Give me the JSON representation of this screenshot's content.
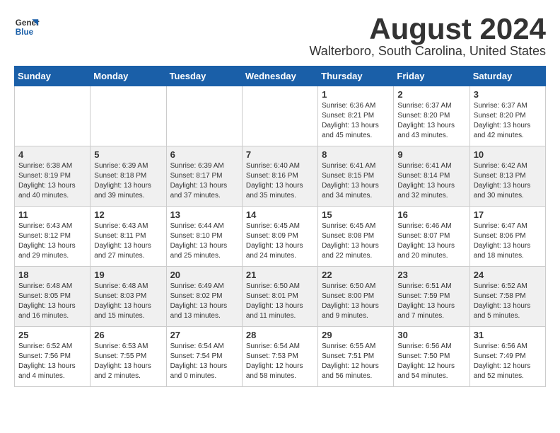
{
  "logo": {
    "line1": "General",
    "line2": "Blue"
  },
  "title": "August 2024",
  "subtitle": "Walterboro, South Carolina, United States",
  "days_of_week": [
    "Sunday",
    "Monday",
    "Tuesday",
    "Wednesday",
    "Thursday",
    "Friday",
    "Saturday"
  ],
  "weeks": [
    [
      {
        "day": "",
        "info": ""
      },
      {
        "day": "",
        "info": ""
      },
      {
        "day": "",
        "info": ""
      },
      {
        "day": "",
        "info": ""
      },
      {
        "day": "1",
        "info": "Sunrise: 6:36 AM\nSunset: 8:21 PM\nDaylight: 13 hours\nand 45 minutes."
      },
      {
        "day": "2",
        "info": "Sunrise: 6:37 AM\nSunset: 8:20 PM\nDaylight: 13 hours\nand 43 minutes."
      },
      {
        "day": "3",
        "info": "Sunrise: 6:37 AM\nSunset: 8:20 PM\nDaylight: 13 hours\nand 42 minutes."
      }
    ],
    [
      {
        "day": "4",
        "info": "Sunrise: 6:38 AM\nSunset: 8:19 PM\nDaylight: 13 hours\nand 40 minutes."
      },
      {
        "day": "5",
        "info": "Sunrise: 6:39 AM\nSunset: 8:18 PM\nDaylight: 13 hours\nand 39 minutes."
      },
      {
        "day": "6",
        "info": "Sunrise: 6:39 AM\nSunset: 8:17 PM\nDaylight: 13 hours\nand 37 minutes."
      },
      {
        "day": "7",
        "info": "Sunrise: 6:40 AM\nSunset: 8:16 PM\nDaylight: 13 hours\nand 35 minutes."
      },
      {
        "day": "8",
        "info": "Sunrise: 6:41 AM\nSunset: 8:15 PM\nDaylight: 13 hours\nand 34 minutes."
      },
      {
        "day": "9",
        "info": "Sunrise: 6:41 AM\nSunset: 8:14 PM\nDaylight: 13 hours\nand 32 minutes."
      },
      {
        "day": "10",
        "info": "Sunrise: 6:42 AM\nSunset: 8:13 PM\nDaylight: 13 hours\nand 30 minutes."
      }
    ],
    [
      {
        "day": "11",
        "info": "Sunrise: 6:43 AM\nSunset: 8:12 PM\nDaylight: 13 hours\nand 29 minutes."
      },
      {
        "day": "12",
        "info": "Sunrise: 6:43 AM\nSunset: 8:11 PM\nDaylight: 13 hours\nand 27 minutes."
      },
      {
        "day": "13",
        "info": "Sunrise: 6:44 AM\nSunset: 8:10 PM\nDaylight: 13 hours\nand 25 minutes."
      },
      {
        "day": "14",
        "info": "Sunrise: 6:45 AM\nSunset: 8:09 PM\nDaylight: 13 hours\nand 24 minutes."
      },
      {
        "day": "15",
        "info": "Sunrise: 6:45 AM\nSunset: 8:08 PM\nDaylight: 13 hours\nand 22 minutes."
      },
      {
        "day": "16",
        "info": "Sunrise: 6:46 AM\nSunset: 8:07 PM\nDaylight: 13 hours\nand 20 minutes."
      },
      {
        "day": "17",
        "info": "Sunrise: 6:47 AM\nSunset: 8:06 PM\nDaylight: 13 hours\nand 18 minutes."
      }
    ],
    [
      {
        "day": "18",
        "info": "Sunrise: 6:48 AM\nSunset: 8:05 PM\nDaylight: 13 hours\nand 16 minutes."
      },
      {
        "day": "19",
        "info": "Sunrise: 6:48 AM\nSunset: 8:03 PM\nDaylight: 13 hours\nand 15 minutes."
      },
      {
        "day": "20",
        "info": "Sunrise: 6:49 AM\nSunset: 8:02 PM\nDaylight: 13 hours\nand 13 minutes."
      },
      {
        "day": "21",
        "info": "Sunrise: 6:50 AM\nSunset: 8:01 PM\nDaylight: 13 hours\nand 11 minutes."
      },
      {
        "day": "22",
        "info": "Sunrise: 6:50 AM\nSunset: 8:00 PM\nDaylight: 13 hours\nand 9 minutes."
      },
      {
        "day": "23",
        "info": "Sunrise: 6:51 AM\nSunset: 7:59 PM\nDaylight: 13 hours\nand 7 minutes."
      },
      {
        "day": "24",
        "info": "Sunrise: 6:52 AM\nSunset: 7:58 PM\nDaylight: 13 hours\nand 5 minutes."
      }
    ],
    [
      {
        "day": "25",
        "info": "Sunrise: 6:52 AM\nSunset: 7:56 PM\nDaylight: 13 hours\nand 4 minutes."
      },
      {
        "day": "26",
        "info": "Sunrise: 6:53 AM\nSunset: 7:55 PM\nDaylight: 13 hours\nand 2 minutes."
      },
      {
        "day": "27",
        "info": "Sunrise: 6:54 AM\nSunset: 7:54 PM\nDaylight: 13 hours\nand 0 minutes."
      },
      {
        "day": "28",
        "info": "Sunrise: 6:54 AM\nSunset: 7:53 PM\nDaylight: 12 hours\nand 58 minutes."
      },
      {
        "day": "29",
        "info": "Sunrise: 6:55 AM\nSunset: 7:51 PM\nDaylight: 12 hours\nand 56 minutes."
      },
      {
        "day": "30",
        "info": "Sunrise: 6:56 AM\nSunset: 7:50 PM\nDaylight: 12 hours\nand 54 minutes."
      },
      {
        "day": "31",
        "info": "Sunrise: 6:56 AM\nSunset: 7:49 PM\nDaylight: 12 hours\nand 52 minutes."
      }
    ]
  ]
}
